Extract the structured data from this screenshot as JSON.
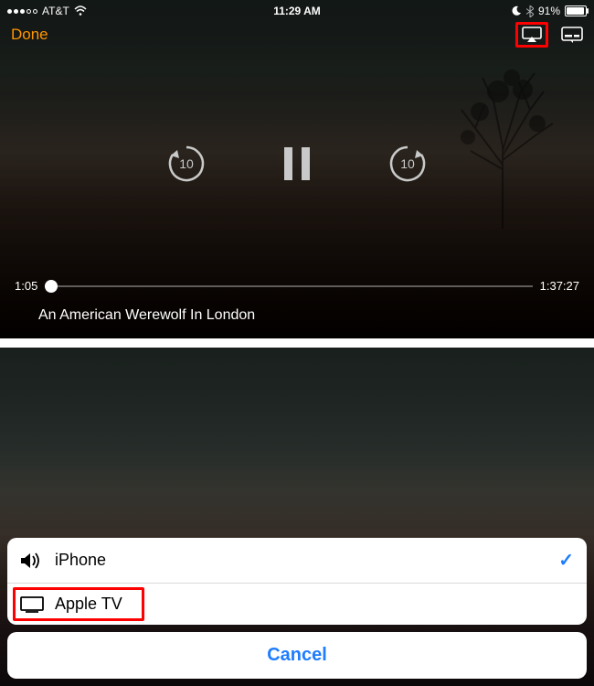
{
  "status": {
    "carrier": "AT&T",
    "time": "11:29 AM",
    "battery_pct": "91%"
  },
  "nav": {
    "done_label": "Done"
  },
  "playback": {
    "skip_seconds": "10",
    "elapsed": "1:05",
    "total": "1:37:27",
    "title": "An American Werewolf In London"
  },
  "airplay": {
    "devices": [
      {
        "label": "iPhone",
        "selected": true
      },
      {
        "label": "Apple TV",
        "selected": false
      }
    ],
    "cancel_label": "Cancel"
  }
}
